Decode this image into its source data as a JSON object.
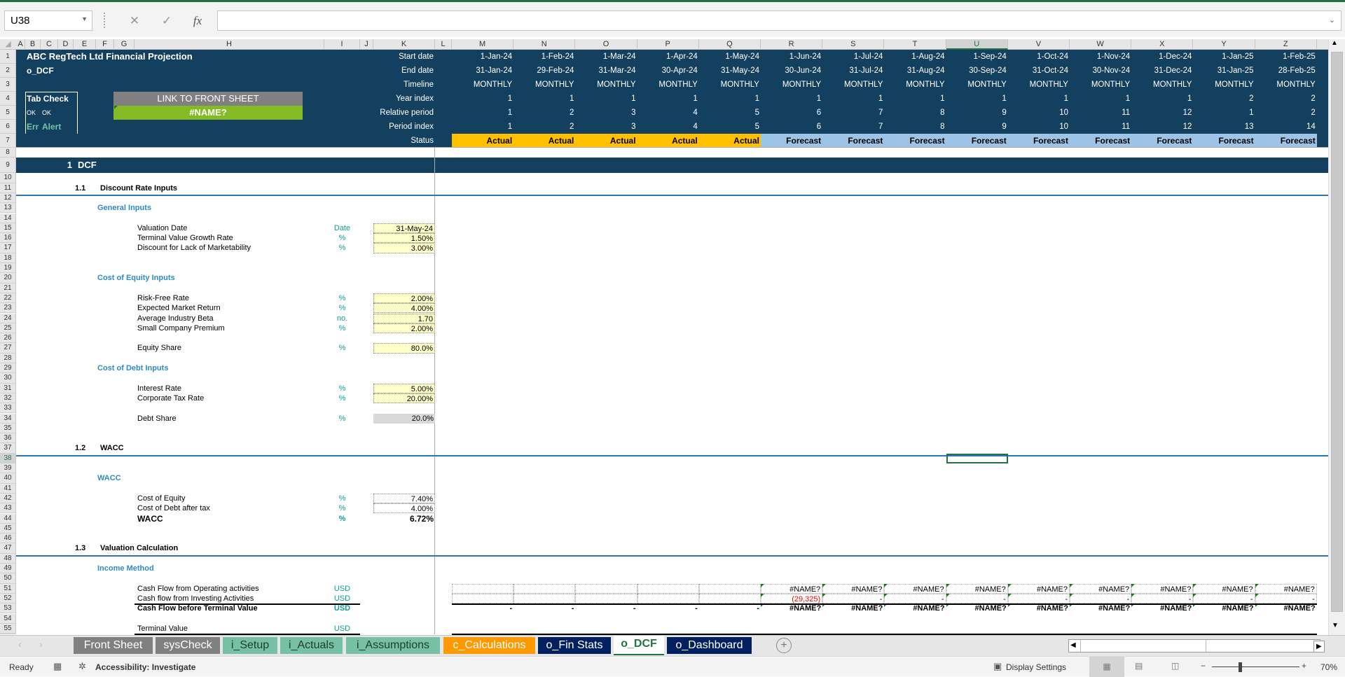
{
  "formula_bar": {
    "name_box": "U38",
    "cancel_icon": "✕",
    "enter_icon": "✓",
    "fx_label": "fx",
    "formula": ""
  },
  "columns": [
    "A",
    "B",
    "C",
    "D",
    "E",
    "F",
    "G",
    "H",
    "I",
    "J",
    "K",
    "L",
    "M",
    "N",
    "O",
    "P",
    "Q",
    "R",
    "S",
    "T",
    "U",
    "V",
    "W",
    "X",
    "Y",
    "Z"
  ],
  "selected_cell": {
    "column": "U",
    "row": 38
  },
  "header": {
    "title": "ABC RegTech Ltd Financial Projection",
    "sheet_name": "o_DCF",
    "tab_check": {
      "title": "Tab Check",
      "ok1": "OK",
      "ok2": "OK",
      "err": "Err",
      "alert": "Alert"
    },
    "link_button": "LINK TO FRONT SHEET",
    "link_value": "#NAME?",
    "timeline_labels": [
      "Start date",
      "End date",
      "Timeline",
      "Year index",
      "Relative period",
      "Period index",
      "Status"
    ]
  },
  "periods": [
    {
      "start": "1-Jan-24",
      "end": "31-Jan-24",
      "timeline": "MONTHLY",
      "year": "1",
      "rel": "1",
      "idx": "1",
      "status": "Actual"
    },
    {
      "start": "1-Feb-24",
      "end": "29-Feb-24",
      "timeline": "MONTHLY",
      "year": "1",
      "rel": "2",
      "idx": "2",
      "status": "Actual"
    },
    {
      "start": "1-Mar-24",
      "end": "31-Mar-24",
      "timeline": "MONTHLY",
      "year": "1",
      "rel": "3",
      "idx": "3",
      "status": "Actual"
    },
    {
      "start": "1-Apr-24",
      "end": "30-Apr-24",
      "timeline": "MONTHLY",
      "year": "1",
      "rel": "4",
      "idx": "4",
      "status": "Actual"
    },
    {
      "start": "1-May-24",
      "end": "31-May-24",
      "timeline": "MONTHLY",
      "year": "1",
      "rel": "5",
      "idx": "5",
      "status": "Actual"
    },
    {
      "start": "1-Jun-24",
      "end": "30-Jun-24",
      "timeline": "MONTHLY",
      "year": "1",
      "rel": "6",
      "idx": "6",
      "status": "Forecast"
    },
    {
      "start": "1-Jul-24",
      "end": "31-Jul-24",
      "timeline": "MONTHLY",
      "year": "1",
      "rel": "7",
      "idx": "7",
      "status": "Forecast"
    },
    {
      "start": "1-Aug-24",
      "end": "31-Aug-24",
      "timeline": "MONTHLY",
      "year": "1",
      "rel": "8",
      "idx": "8",
      "status": "Forecast"
    },
    {
      "start": "1-Sep-24",
      "end": "30-Sep-24",
      "timeline": "MONTHLY",
      "year": "1",
      "rel": "9",
      "idx": "9",
      "status": "Forecast"
    },
    {
      "start": "1-Oct-24",
      "end": "31-Oct-24",
      "timeline": "MONTHLY",
      "year": "1",
      "rel": "10",
      "idx": "10",
      "status": "Forecast"
    },
    {
      "start": "1-Nov-24",
      "end": "30-Nov-24",
      "timeline": "MONTHLY",
      "year": "1",
      "rel": "11",
      "idx": "11",
      "status": "Forecast"
    },
    {
      "start": "1-Dec-24",
      "end": "31-Dec-24",
      "timeline": "MONTHLY",
      "year": "1",
      "rel": "12",
      "idx": "12",
      "status": "Forecast"
    },
    {
      "start": "1-Jan-25",
      "end": "31-Jan-25",
      "timeline": "MONTHLY",
      "year": "2",
      "rel": "1",
      "idx": "13",
      "status": "Forecast"
    },
    {
      "start": "1-Feb-25",
      "end": "28-Feb-25",
      "timeline": "MONTHLY",
      "year": "2",
      "rel": "2",
      "idx": "14",
      "status": "Forecast"
    }
  ],
  "section": {
    "num": "1",
    "title": "DCF"
  },
  "subsections": [
    {
      "num": "1.1",
      "title": "Discount Rate Inputs"
    },
    {
      "num": "1.2",
      "title": "WACC"
    },
    {
      "num": "1.3",
      "title": "Valuation Calculation"
    }
  ],
  "groups": {
    "general": "General Inputs",
    "equity": "Cost of Equity Inputs",
    "debt": "Cost of Debt Inputs",
    "wacc": "WACC",
    "income": "Income Method"
  },
  "inputs": [
    {
      "label": "Valuation Date",
      "unit": "Date",
      "value": "31-May-24"
    },
    {
      "label": "Terminal Value Growth Rate",
      "unit": "%",
      "value": "1.50%"
    },
    {
      "label": "Discount for Lack of Marketability",
      "unit": "%",
      "value": "3.00%"
    },
    {
      "label": "Risk-Free Rate",
      "unit": "%",
      "value": "2.00%"
    },
    {
      "label": "Expected Market Return",
      "unit": "%",
      "value": "4.00%"
    },
    {
      "label": "Average Industry Beta",
      "unit": "no.",
      "value": "1.70"
    },
    {
      "label": "Small Company Premium",
      "unit": "%",
      "value": "2.00%"
    },
    {
      "label": "Equity Share",
      "unit": "%",
      "value": "80.0%"
    },
    {
      "label": "Interest Rate",
      "unit": "%",
      "value": "5.00%"
    },
    {
      "label": "Corporate Tax Rate",
      "unit": "%",
      "value": "20.00%"
    },
    {
      "label": "Debt Share",
      "unit": "%",
      "value": "20.0%"
    },
    {
      "label": "Cost of Equity",
      "unit": "%",
      "value": "7.40%"
    },
    {
      "label": "Cost of Debt after tax",
      "unit": "%",
      "value": "4.00%"
    },
    {
      "label": "WACC",
      "unit": "%",
      "value": "6.72%"
    }
  ],
  "income_rows": [
    {
      "label": "Cash Flow from Operating activities",
      "unit": "USD",
      "values": [
        "",
        "",
        "",
        "",
        "",
        "#NAME?",
        "#NAME?",
        "#NAME?",
        "#NAME?",
        "#NAME?",
        "#NAME?",
        "#NAME?",
        "#NAME?",
        "#NAME?"
      ]
    },
    {
      "label": "Cash flow from Investing Activities",
      "unit": "USD",
      "values": [
        "",
        "",
        "",
        "",
        "",
        "(29,325)",
        "-",
        "-",
        "-",
        "-",
        "-",
        "-",
        "-",
        "-"
      ]
    },
    {
      "label": "Cash Flow before Terminal Value",
      "unit": "USD",
      "values": [
        "-",
        "-",
        "-",
        "-",
        "-",
        "#NAME?",
        "#NAME?",
        "#NAME?",
        "#NAME?",
        "#NAME?",
        "#NAME?",
        "#NAME?",
        "#NAME?",
        "#NAME?"
      ]
    },
    {
      "label": "Terminal Value",
      "unit": "USD",
      "values": []
    }
  ],
  "sheet_tabs": [
    {
      "label": "Front Sheet",
      "color": "#808080"
    },
    {
      "label": "sysCheck",
      "color": "#808080"
    },
    {
      "label": "i_Setup",
      "color": "#76c0a6"
    },
    {
      "label": "i_Actuals",
      "color": "#76c0a6"
    },
    {
      "label": "i_Assumptions",
      "color": "#76c0a6"
    },
    {
      "label": "c_Calculations",
      "color": "#ff9900"
    },
    {
      "label": "o_Fin Stats",
      "color": "#002060"
    },
    {
      "label": "o_DCF",
      "color": "#ffffff",
      "active": true
    },
    {
      "label": "o_Dashboard",
      "color": "#002060"
    }
  ],
  "status_bar": {
    "ready": "Ready",
    "accessibility": "Accessibility: Investigate",
    "display_settings": "Display Settings",
    "zoom": "70%",
    "zoom_minus": "−",
    "zoom_plus": "+"
  },
  "colors": {
    "header_band": "#14405f",
    "actual": "#ffc000",
    "forecast": "#9dc3e6",
    "link_button": "#808080",
    "link_value": "#84bb25",
    "units": "#0e9c9c",
    "group_heading": "#2e8bc8",
    "input_fill": "#ffffcc",
    "error_text": "#ff0000"
  }
}
